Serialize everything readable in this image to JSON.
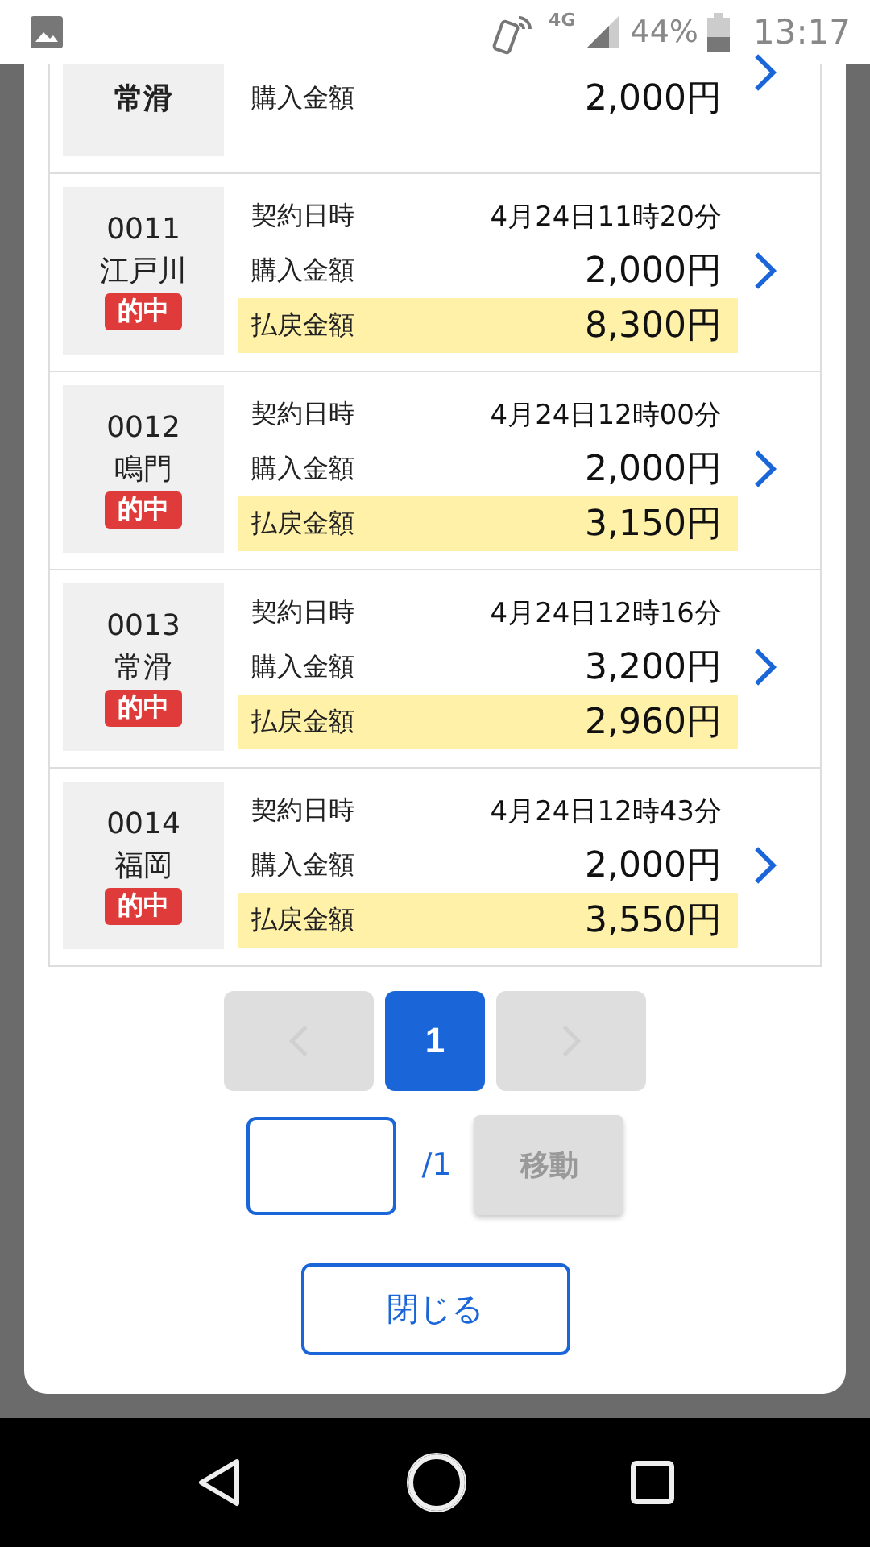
{
  "status_bar": {
    "network": "4G",
    "battery": "44%",
    "time": "13:17"
  },
  "tickets": [
    {
      "kind": "partial",
      "venue": "常滑",
      "rows": [
        {
          "label": "購入金額",
          "value": "2,000円",
          "highlighted": false
        }
      ]
    },
    {
      "kind": "full",
      "number": "0011",
      "venue": "江戸川",
      "badge": "的中",
      "rows": [
        {
          "label": "契約日時",
          "value": "4月24日11時20分",
          "highlighted": false
        },
        {
          "label": "購入金額",
          "value": "2,000円",
          "highlighted": false
        },
        {
          "label": "払戻金額",
          "value": "8,300円",
          "highlighted": true
        }
      ]
    },
    {
      "kind": "full",
      "number": "0012",
      "venue": "鳴門",
      "badge": "的中",
      "rows": [
        {
          "label": "契約日時",
          "value": "4月24日12時00分",
          "highlighted": false
        },
        {
          "label": "購入金額",
          "value": "2,000円",
          "highlighted": false
        },
        {
          "label": "払戻金額",
          "value": "3,150円",
          "highlighted": true
        }
      ]
    },
    {
      "kind": "full",
      "number": "0013",
      "venue": "常滑",
      "badge": "的中",
      "rows": [
        {
          "label": "契約日時",
          "value": "4月24日12時16分",
          "highlighted": false
        },
        {
          "label": "購入金額",
          "value": "3,200円",
          "highlighted": false
        },
        {
          "label": "払戻金額",
          "value": "2,960円",
          "highlighted": true
        }
      ]
    },
    {
      "kind": "full",
      "number": "0014",
      "venue": "福岡",
      "badge": "的中",
      "rows": [
        {
          "label": "契約日時",
          "value": "4月24日12時43分",
          "highlighted": false
        },
        {
          "label": "購入金額",
          "value": "2,000円",
          "highlighted": false
        },
        {
          "label": "払戻金額",
          "value": "3,550円",
          "highlighted": true
        }
      ]
    }
  ],
  "pagination": {
    "prev_disabled": true,
    "next_disabled": true,
    "pages": [
      {
        "label": "1",
        "selected": true
      }
    ]
  },
  "jump": {
    "total": "/1",
    "button": "移動",
    "button_disabled": true
  },
  "close_button": "閉じる"
}
